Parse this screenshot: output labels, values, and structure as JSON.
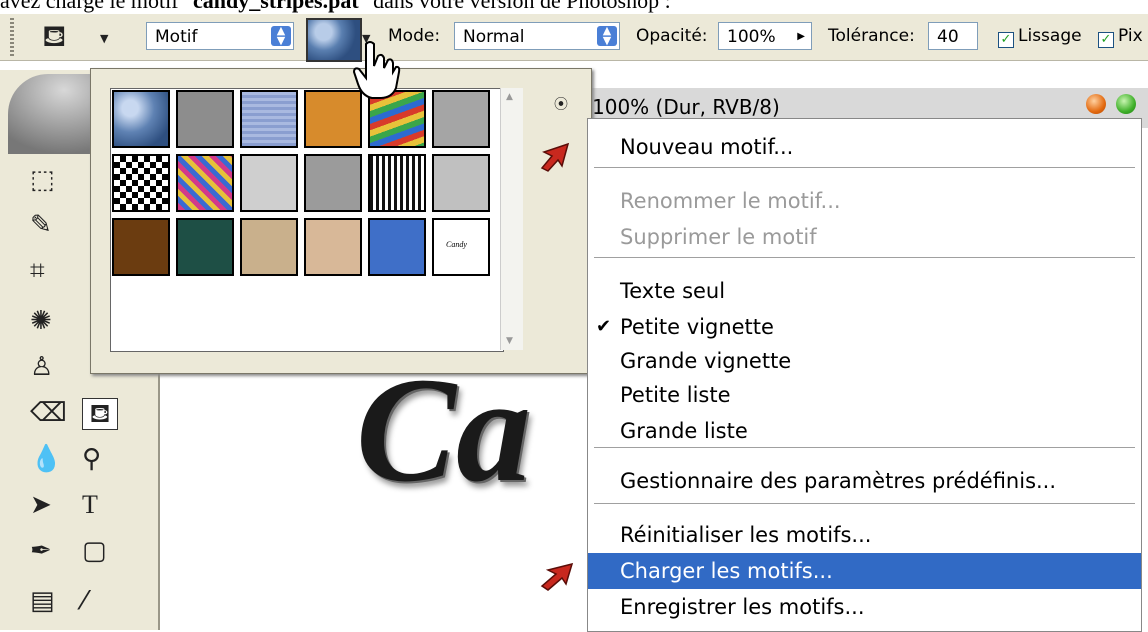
{
  "caption": {
    "pre": "avez chargé le motif \"",
    "file": "candy_stripes.pat",
    "post": "\" dans votre version de Photoshop :"
  },
  "options_bar": {
    "fill_source": "Motif",
    "mode_label": "Mode:",
    "mode_value": "Normal",
    "opacity_label": "Opacité:",
    "opacity_value": "100%",
    "tolerance_label": "Tolérance:",
    "tolerance_value": "40",
    "smooth_label": "Lissage",
    "pixels_label": "Pix",
    "smooth_checked": true,
    "pixels_checked": true
  },
  "document": {
    "title": "100% (Dur, RVB/8)",
    "canvas_text": "Ca"
  },
  "picker": {
    "menu_button_icon": "circle-arrow-icon",
    "patterns": [
      {
        "id": "bubbles",
        "color": "#5f82b3"
      },
      {
        "id": "noise-gray",
        "color": "#8d8d8d"
      },
      {
        "id": "blue-stripes",
        "color": "#8a9ed0"
      },
      {
        "id": "orange-weave",
        "color": "#d78b2c"
      },
      {
        "id": "rainbow",
        "color": "#4a8e6a"
      },
      {
        "id": "gray-marble",
        "color": "#a5a5a5"
      },
      {
        "id": "checker",
        "color": "#7a7a7a"
      },
      {
        "id": "confetti",
        "color": "#b8468a"
      },
      {
        "id": "clouds",
        "color": "#cfcfcf"
      },
      {
        "id": "granite",
        "color": "#9b9b9b"
      },
      {
        "id": "mesh",
        "color": "#6d6d6d"
      },
      {
        "id": "stone",
        "color": "#c0c0c0"
      },
      {
        "id": "brown-wood",
        "color": "#6b3c10"
      },
      {
        "id": "teal-hearts",
        "color": "#1e4f45"
      },
      {
        "id": "photo-ballet",
        "color": "#c9b08c"
      },
      {
        "id": "tan",
        "color": "#d8b898"
      },
      {
        "id": "blue-noise",
        "color": "#3f6fc8"
      },
      {
        "id": "candy",
        "color": "#ffffff"
      }
    ],
    "candy_label": "Candy"
  },
  "context_menu": {
    "items": [
      {
        "label": "Nouveau motif...",
        "disabled": false,
        "checked": false,
        "selected": false
      },
      {
        "label": "Renommer le motif...",
        "disabled": true,
        "checked": false,
        "selected": false
      },
      {
        "label": "Supprimer le motif",
        "disabled": true,
        "checked": false,
        "selected": false
      },
      {
        "label": "Texte seul",
        "disabled": false,
        "checked": false,
        "selected": false
      },
      {
        "label": "Petite vignette",
        "disabled": false,
        "checked": true,
        "selected": false
      },
      {
        "label": "Grande vignette",
        "disabled": false,
        "checked": false,
        "selected": false
      },
      {
        "label": "Petite liste",
        "disabled": false,
        "checked": false,
        "selected": false
      },
      {
        "label": "Grande liste",
        "disabled": false,
        "checked": false,
        "selected": false
      },
      {
        "label": "Gestionnaire des paramètres prédéfinis...",
        "disabled": false,
        "checked": false,
        "selected": false
      },
      {
        "label": "Réinitialiser les motifs...",
        "disabled": false,
        "checked": false,
        "selected": false
      },
      {
        "label": "Charger les motifs...",
        "disabled": false,
        "checked": false,
        "selected": true
      },
      {
        "label": "Enregistrer les motifs...",
        "disabled": false,
        "checked": false,
        "selected": false
      }
    ],
    "check_mark": "✔"
  },
  "colors": {
    "menu_highlight": "#316ac5",
    "annotation_arrow": "#c8281e",
    "chrome": "#ece9d8"
  }
}
